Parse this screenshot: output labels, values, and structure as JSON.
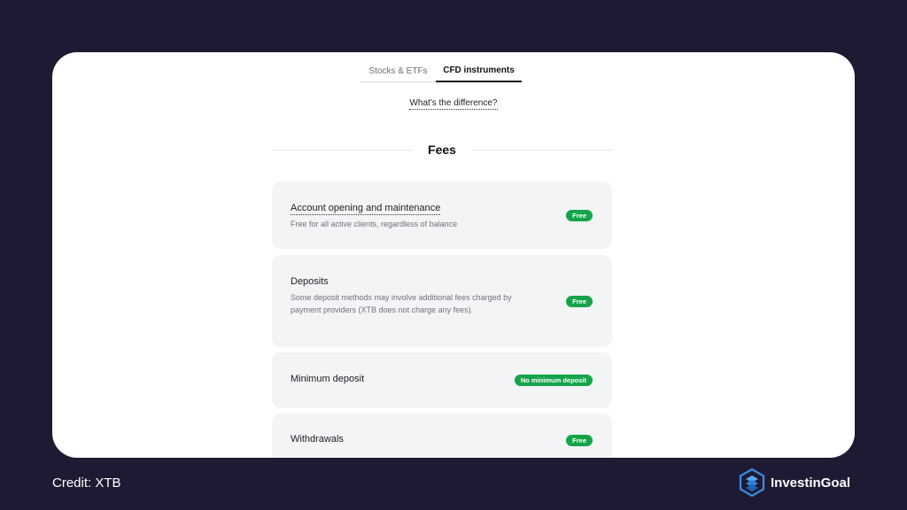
{
  "tabs": [
    {
      "label": "Stocks & ETFs",
      "active": false
    },
    {
      "label": "CFD instruments",
      "active": true
    }
  ],
  "difference_link": "What's the difference?",
  "section_title": "Fees",
  "fees": [
    {
      "title": "Account opening and maintenance",
      "description": "Free for all active clients, regardless of balance",
      "badge": "Free"
    },
    {
      "title": "Deposits",
      "description": "Some deposit methods may involve additional fees charged by payment providers (XTB does not charge any fees).",
      "badge": "Free"
    },
    {
      "title": "Minimum deposit",
      "badge": "No minimum deposit"
    },
    {
      "title": "Withdrawals",
      "badge": "Free"
    }
  ],
  "credit": "Credit: XTB",
  "brand": "InvestinGoal",
  "colors": {
    "background": "#1f1a33",
    "badge": "#16a44a",
    "logo_blue": "#3b8de0"
  }
}
